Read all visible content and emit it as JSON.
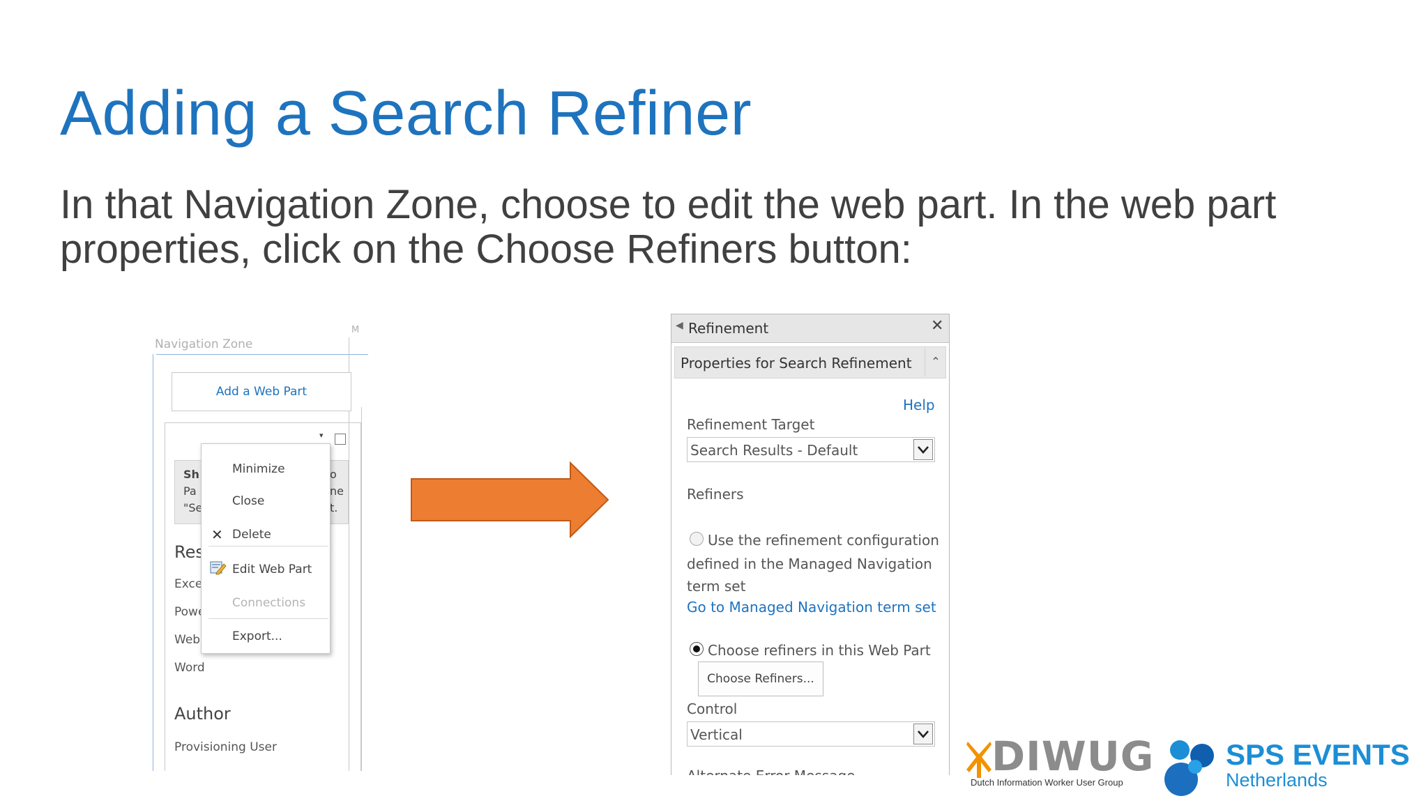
{
  "slide": {
    "title": "Adding a Search Refiner",
    "body_line1": "In that Navigation Zone, choose to edit the web part.  In the web part",
    "body_line2": "properties, click on the Choose Refiners button:"
  },
  "left_screenshot": {
    "zone_label": "Navigation Zone",
    "corner_label": "M",
    "add_web_part": "Add a Web Part",
    "info_box": {
      "line1": "Sh",
      "line2": "Pa",
      "line3": "\"Se",
      "right1": "o",
      "right2": "ne",
      "right3": "t."
    },
    "results_heading": "Res",
    "result_items": [
      "Excel",
      "Powe",
      "Web",
      "Word"
    ],
    "author_heading": "Author",
    "author_value": "Provisioning User",
    "context_menu": {
      "minimize": "Minimize",
      "close": "Close",
      "delete": "Delete",
      "edit_web_part": "Edit Web Part",
      "connections": "Connections",
      "export": "Export..."
    }
  },
  "refinement_panel": {
    "header_title": "Refinement",
    "properties_title": "Properties for Search Refinement",
    "help_link": "Help",
    "refinement_target_label": "Refinement Target",
    "refinement_target_value": "Search Results - Default",
    "refiners_label": "Refiners",
    "option_managed_line1": "Use the refinement configuration",
    "option_managed_line2": "defined in the Managed Navigation",
    "option_managed_line3": "term set",
    "managed_nav_link": "Go to Managed Navigation term set",
    "option_webpart": "Choose refiners in this Web Part",
    "choose_refiners_button": "Choose Refiners...",
    "control_label": "Control",
    "control_value": "Vertical",
    "cut_off_label": "Alternate Error Message"
  },
  "logos": {
    "diwug_name": "DIWUG",
    "diwug_tagline": "Dutch Information Worker User Group",
    "sps_line1": "SPS EVENTS",
    "sps_line2": "Netherlands"
  },
  "colors": {
    "title_blue": "#1e73be",
    "arrow_orange": "#ed7d31",
    "diwug_orange": "#f39200",
    "diwug_gray": "#8c8c8c",
    "sps_blue": "#1c8ed6"
  }
}
